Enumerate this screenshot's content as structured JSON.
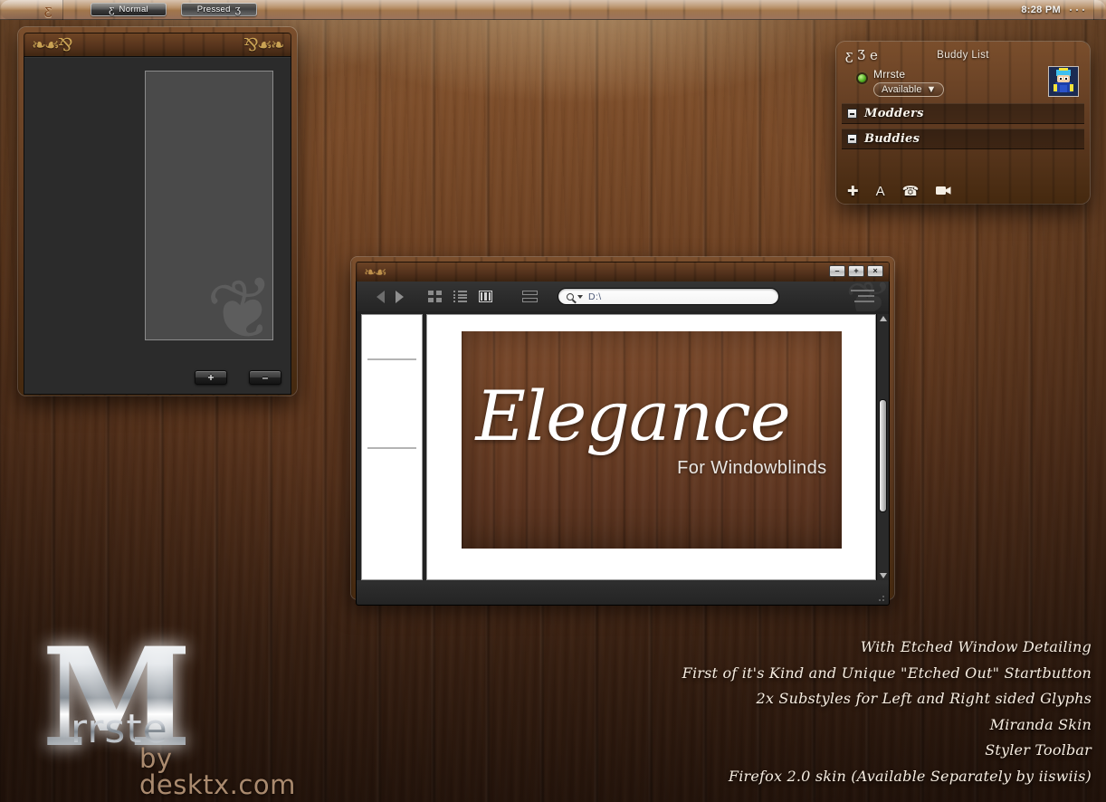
{
  "desktop": {
    "theme_name": "Elegance",
    "background": "wood-planks",
    "colors": {
      "wood_light": "#8a5a33",
      "wood_dark": "#301a0e",
      "accent_gold": "#e4ba60",
      "panel_dark": "#2b2b2b"
    }
  },
  "taskbar": {
    "start_icon": "swirl-startbutton-icon",
    "buttons": [
      {
        "label": "Normal",
        "icon": "swirl-glyph-icon",
        "state": "normal"
      },
      {
        "label": "Pressed",
        "icon": "swirl-glyph-icon",
        "state": "pressed"
      }
    ],
    "tray": {
      "clock": "8:28 PM",
      "dots": 3
    }
  },
  "preview_window": {
    "title": "",
    "ornament_left": "❧☙⅋",
    "ornament_right": "⅋☙❧",
    "flourish": "❦",
    "buttons": [
      {
        "label": "+",
        "name": "plus-button"
      },
      {
        "label": "–",
        "name": "minus-button"
      }
    ]
  },
  "buddy_list": {
    "title": "Buddy List",
    "header_glyphs": [
      "glyph-one",
      "glyph-two",
      "glyph-three"
    ],
    "glyph_chars": [
      "ʒ",
      "Ʒ",
      "ɘ"
    ],
    "account": {
      "name": "Mrrste",
      "status": "Available",
      "status_caret": "▼",
      "presence": "online",
      "avatar": "cartman-avatar"
    },
    "groups": [
      {
        "name": "Modders",
        "expanded": true,
        "toggle": "−"
      },
      {
        "name": "Buddies",
        "expanded": true,
        "toggle": "−"
      }
    ],
    "footer_actions": [
      {
        "name": "add-contact",
        "glyph": "✚"
      },
      {
        "name": "font-options",
        "glyph": "A"
      },
      {
        "name": "voice-call",
        "glyph": "☎"
      },
      {
        "name": "video-call",
        "glyph": "▶"
      }
    ]
  },
  "explorer": {
    "ornament": "❧☙",
    "caption_buttons": [
      {
        "name": "minimize",
        "label": "–"
      },
      {
        "name": "maximize",
        "label": "+"
      },
      {
        "name": "close",
        "label": "×"
      }
    ],
    "nav": {
      "back": "back-arrow",
      "forward": "forward-arrow"
    },
    "view_modes": [
      {
        "name": "icon-view",
        "selected": false
      },
      {
        "name": "list-view",
        "selected": false
      },
      {
        "name": "column-view",
        "selected": true
      },
      {
        "name": "coverflow-view",
        "selected": false
      }
    ],
    "search": {
      "value": "D:\\",
      "placeholder": "",
      "icon": "search-magnifier-icon",
      "caret": "▼"
    },
    "menu_icon": "hamburger-menu-icon",
    "sidebar": {
      "separators": 2
    },
    "preview": {
      "title": "Elegance",
      "subtitle": "For Windowblinds"
    },
    "scrollbar": {
      "up": "▲",
      "down": "▼",
      "thumb_position": "middle"
    }
  },
  "features": [
    "With Etched Window Detailing",
    "First of it's Kind and Unique \"Etched Out\" Startbutton",
    "2x Substyles for Left and Right sided Glyphs",
    "Miranda Skin",
    "Styler Toolbar",
    "Firefox 2.0 skin (Available Separately by iiswiis)"
  ],
  "logo": {
    "initial": "M",
    "rest": "rrste",
    "credit": "by desktx.com"
  }
}
